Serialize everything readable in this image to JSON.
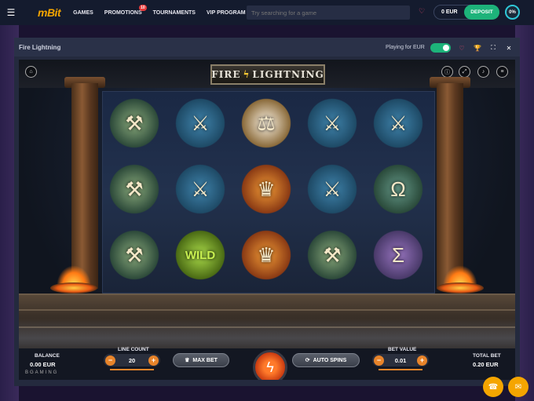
{
  "brand": {
    "logo_main": "mBit",
    "logo_sub": ""
  },
  "nav": {
    "items": [
      {
        "label": "GAMES"
      },
      {
        "label": "PROMOTIONS",
        "badge": "10"
      },
      {
        "label": "TOURNAMENTS"
      },
      {
        "label": "VIP PROGRAM"
      }
    ]
  },
  "search": {
    "placeholder": "Try searching for a game"
  },
  "wallet": {
    "balance": "0 EUR",
    "deposit_label": "DEPOSIT"
  },
  "user": {
    "progress": "0%"
  },
  "game": {
    "title": "Fire Lightning",
    "playing_for": "Playing for EUR",
    "logo_left": "FIRE",
    "logo_right": "LIGHTNING"
  },
  "symbols": {
    "rows": [
      [
        "thor",
        "valkyrie",
        "justice",
        "valkyrie",
        "valkyrie"
      ],
      [
        "thor",
        "valkyrie",
        "zeus",
        "valkyrie",
        "omega"
      ],
      [
        "thor",
        "wild",
        "zeus",
        "thor",
        "sigma"
      ]
    ],
    "wild_text": "WILD",
    "omega_text": "Ω",
    "sigma_text": "Σ"
  },
  "controls": {
    "balance_label": "BALANCE",
    "balance_value": "0.00 EUR",
    "line_count_label": "LINE COUNT",
    "line_count_value": "20",
    "max_bet_label": "MAX BET",
    "auto_spins_label": "AUTO SPINS",
    "bet_value_label": "BET VALUE",
    "bet_value": "0.01",
    "total_bet_label": "TOTAL BET",
    "total_bet_value": "0.20 EUR",
    "provider": "BGAMING"
  },
  "colors": {
    "accent": "#f5a500",
    "deposit": "#1db37a",
    "spin": "#e8542a"
  }
}
